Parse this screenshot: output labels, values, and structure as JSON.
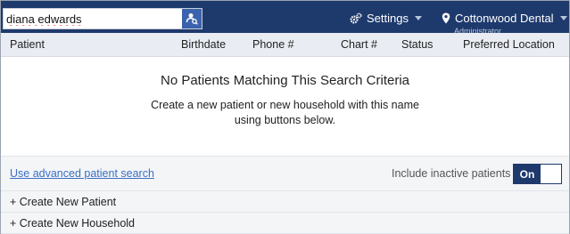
{
  "search": {
    "value": "diana edwards"
  },
  "nav": {
    "settings_label": "Settings",
    "location_label": "Cottonwood Dental",
    "role_label": "Administrator"
  },
  "table": {
    "columns": [
      "Patient",
      "Birthdate",
      "Phone #",
      "Chart #",
      "Status",
      "Preferred Location"
    ]
  },
  "empty_state": {
    "title": "No Patients Matching This Search Criteria",
    "message_line1": "Create a new patient or new household with this name",
    "message_line2": "using buttons below."
  },
  "footer": {
    "advanced_search_link": "Use advanced patient search",
    "inactive_label": "Include inactive patients",
    "toggle_on_label": "On"
  },
  "actions": {
    "create_patient": "+ Create New Patient",
    "create_household": "+ Create New Household"
  },
  "colors": {
    "topbar": "#1e3a6d",
    "search_button": "#3b63ad",
    "link": "#3a6fc4",
    "header_row": "#e9edf3"
  },
  "icons": {
    "search_button": "patient-search-icon",
    "settings": "gears-icon",
    "location": "map-pin-icon"
  }
}
